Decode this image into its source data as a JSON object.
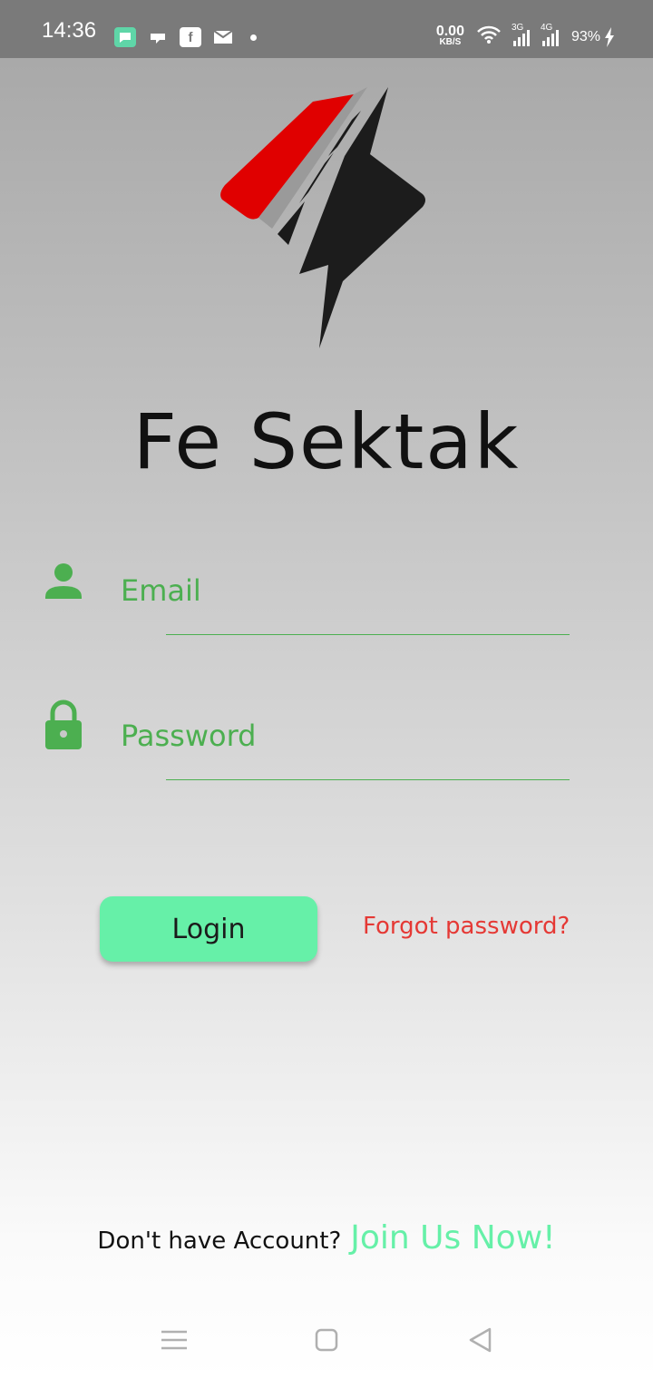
{
  "status_bar": {
    "time": "14:36",
    "net_speed_value": "0.00",
    "net_speed_unit": "KB/S",
    "sim1": "3G",
    "sim2": "4G",
    "battery": "93%"
  },
  "app": {
    "title": "Fe Sektak"
  },
  "form": {
    "email_label": "Email",
    "password_label": "Password",
    "accent_color": "#4caf50"
  },
  "actions": {
    "login": "Login",
    "forgot": "Forgot password?"
  },
  "footer": {
    "question": "Don't have Account?",
    "join": "Join Us Now!"
  },
  "icons": [
    "person-icon",
    "lock-icon",
    "menu-icon",
    "home-icon",
    "back-icon"
  ]
}
